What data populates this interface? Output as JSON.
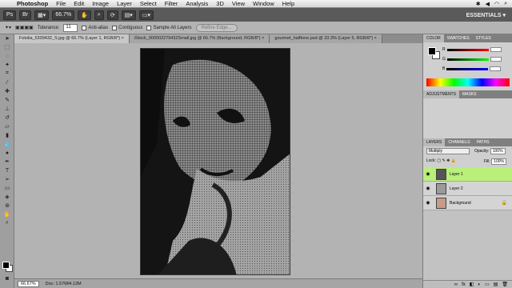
{
  "menubar": {
    "app_name": "Photoshop",
    "items": [
      "File",
      "Edit",
      "Image",
      "Layer",
      "Select",
      "Filter",
      "Analysis",
      "3D",
      "View",
      "Window",
      "Help"
    ]
  },
  "appbar": {
    "zoom": "66.7%",
    "workspace": "ESSENTIALS ▾"
  },
  "options": {
    "tolerance_label": "Tolerance:",
    "tolerance_value": "11",
    "anti_alias": "Anti-alias",
    "contiguous": "Contiguous",
    "sample_all": "Sample All Layers",
    "refine_edge": "Refine Edge..."
  },
  "tabs": [
    {
      "label": "Fotolia_5339432_S.jpg @ 66.7% (Layer 1, RGB/8*) ×",
      "active": true
    },
    {
      "label": "iStock_000002279432Small.jpg @ 66.7% (Background, RGB/8*) ×",
      "active": false
    },
    {
      "label": "gourmet_halftone.psd @ 33.3% (Layer 5, RGB/8*) ×",
      "active": false
    }
  ],
  "status": {
    "zoom": "66.67%",
    "doc": "Doc: 1.57M/4.12M"
  },
  "color_panel": {
    "tabs": [
      "COLOR",
      "SWATCHES",
      "STYLES"
    ],
    "channels": [
      "R",
      "G",
      "B"
    ]
  },
  "adjustments_panel": {
    "tabs": [
      "ADJUSTMENTS",
      "MASKS"
    ]
  },
  "layers_panel": {
    "tabs": [
      "LAYERS",
      "CHANNELS",
      "PATHS"
    ],
    "blend_mode": "Multiply",
    "opacity_label": "Opacity:",
    "opacity": "100%",
    "lock_label": "Lock:",
    "fill_label": "Fill:",
    "fill": "100%",
    "layers": [
      {
        "name": "Layer 1",
        "selected": true
      },
      {
        "name": "Layer 2",
        "selected": false
      },
      {
        "name": "Background",
        "selected": false
      }
    ]
  }
}
